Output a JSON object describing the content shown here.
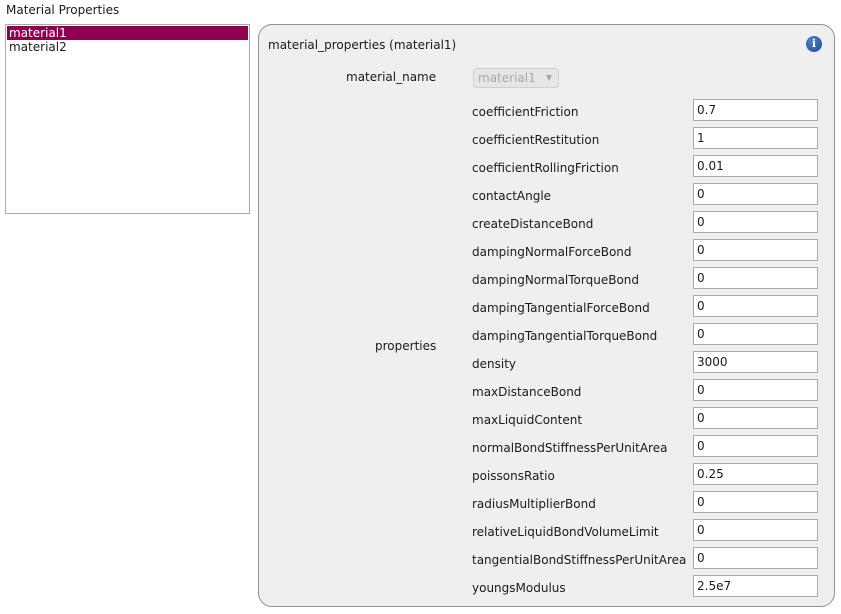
{
  "section_title": "Material Properties",
  "materials": [
    "material1",
    "material2"
  ],
  "selected_material": "material1",
  "panel": {
    "title": "material_properties (material1)",
    "material_name_label": "material_name",
    "material_name_value": "material1",
    "properties_label": "properties"
  },
  "properties": [
    {
      "name": "coefficientFriction",
      "value": "0.7"
    },
    {
      "name": "coefficientRestitution",
      "value": "1"
    },
    {
      "name": "coefficientRollingFriction",
      "value": "0.01"
    },
    {
      "name": "contactAngle",
      "value": "0"
    },
    {
      "name": "createDistanceBond",
      "value": "0"
    },
    {
      "name": "dampingNormalForceBond",
      "value": "0"
    },
    {
      "name": "dampingNormalTorqueBond",
      "value": "0"
    },
    {
      "name": "dampingTangentialForceBond",
      "value": "0"
    },
    {
      "name": "dampingTangentialTorqueBond",
      "value": "0"
    },
    {
      "name": "density",
      "value": "3000"
    },
    {
      "name": "maxDistanceBond",
      "value": "0"
    },
    {
      "name": "maxLiquidContent",
      "value": "0"
    },
    {
      "name": "normalBondStiffnessPerUnitArea",
      "value": "0"
    },
    {
      "name": "poissonsRatio",
      "value": "0.25"
    },
    {
      "name": "radiusMultiplierBond",
      "value": "0"
    },
    {
      "name": "relativeLiquidBondVolumeLimit",
      "value": "0"
    },
    {
      "name": "tangentialBondStiffnessPerUnitArea",
      "value": "0"
    },
    {
      "name": "youngsModulus",
      "value": "2.5e7"
    }
  ],
  "colors": {
    "selection": "#900050",
    "info_icon": "#1d4f9a"
  },
  "icons": {
    "info": "info-icon",
    "dropdown": "chevron-down-icon"
  }
}
